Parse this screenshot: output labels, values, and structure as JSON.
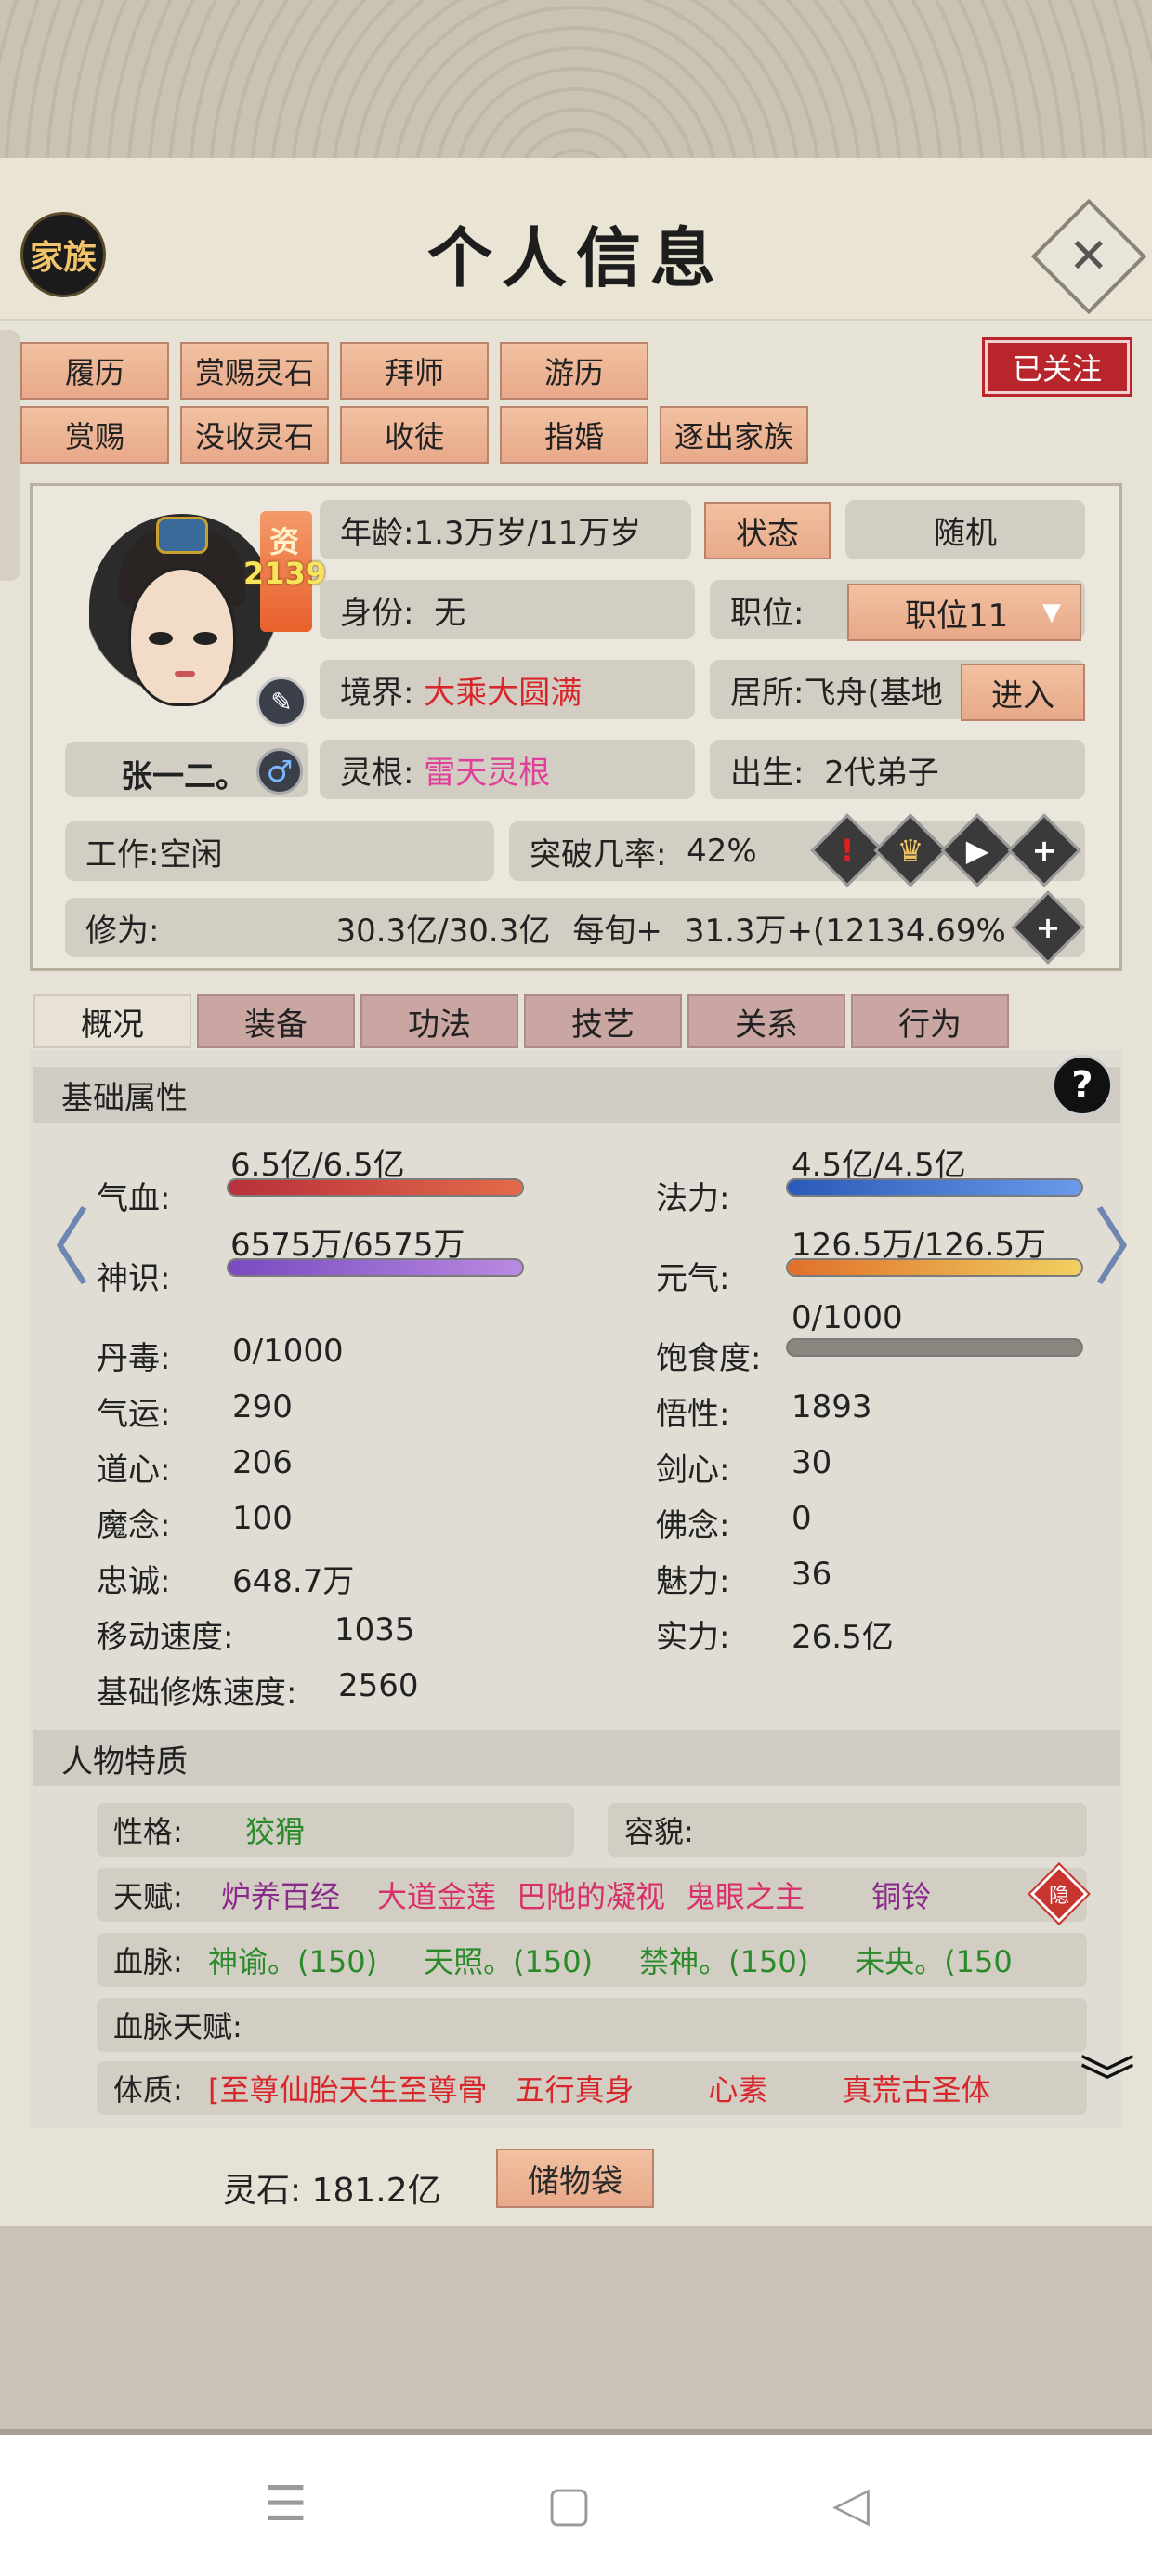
{
  "header": {
    "title": "个人信息",
    "family_button": "家族",
    "close_icon": "✕"
  },
  "actions": {
    "row1": [
      "履历",
      "赏赐灵石",
      "拜师",
      "游历"
    ],
    "row2": [
      "赏赐",
      "没收灵石",
      "收徒",
      "指婚",
      "逐出家族"
    ],
    "follow": "已关注"
  },
  "character": {
    "name": "张一二。",
    "aptitude_label": "资",
    "aptitude_value": "2139",
    "age_label": "年龄:",
    "age_value": "1.3万岁/11万岁",
    "status_button": "状态",
    "random_button": "随机",
    "identity_label": "身份:",
    "identity_value": "无",
    "position_label": "职位:",
    "position_value": "职位11",
    "realm_label": "境界:",
    "realm_value": "大乘大圆满",
    "residence_label": "居所:",
    "residence_value": "飞舟(基地",
    "enter_button": "进入",
    "root_label": "灵根:",
    "root_value": "雷天灵根",
    "birth_label": "出生:",
    "birth_value": "2代弟子",
    "job_label": "工作:",
    "job_value": "空闲",
    "breakthrough_label": "突破几率:",
    "breakthrough_value": "42%",
    "cultivation_label": "修为:",
    "cultivation_value": "30.3亿/30.3亿",
    "per_turn_label": "每旬+",
    "per_turn_value": "31.3万+(12134.69%"
  },
  "tabs": [
    "概况",
    "装备",
    "功法",
    "技艺",
    "关系",
    "行为"
  ],
  "basic": {
    "title": "基础属性",
    "qixue_label": "气血:",
    "qixue_value": "6.5亿/6.5亿",
    "qixue_fill": 1.0,
    "fali_label": "法力:",
    "fali_value": "4.5亿/4.5亿",
    "fali_fill": 1.0,
    "shenshi_label": "神识:",
    "shenshi_value": "6575万/6575万",
    "shenshi_fill": 1.0,
    "yuanqi_label": "元气:",
    "yuanqi_value": "126.5万/126.5万",
    "yuanqi_fill": 1.0,
    "baoshi_label": "饱食度:",
    "baoshi_value": "0/1000",
    "baoshi_fill": 0.0,
    "stats_left": [
      {
        "label": "丹毒:",
        "value": "0/1000"
      },
      {
        "label": "气运:",
        "value": "290"
      },
      {
        "label": "道心:",
        "value": "206"
      },
      {
        "label": "魔念:",
        "value": "100"
      },
      {
        "label": "忠诚:",
        "value": "648.7万"
      },
      {
        "label": "移动速度:",
        "value": "1035"
      },
      {
        "label": "基础修炼速度:",
        "value": "2560"
      }
    ],
    "stats_right": [
      {
        "label": "悟性:",
        "value": "1893"
      },
      {
        "label": "剑心:",
        "value": "30"
      },
      {
        "label": "佛念:",
        "value": "0"
      },
      {
        "label": "魅力:",
        "value": "36"
      },
      {
        "label": "实力:",
        "value": "26.5亿"
      }
    ]
  },
  "traits": {
    "title": "人物特质",
    "personality_label": "性格:",
    "personality_value": "狡猾",
    "appearance_label": "容貌:",
    "talent_label": "天赋:",
    "talents": [
      "炉养百经",
      "大道金莲",
      "巴阤的凝视",
      "鬼眼之主",
      "铜铃"
    ],
    "hide_button": "隐",
    "bloodline_label": "血脉:",
    "bloodlines": [
      "神谕。(150)",
      "天照。(150)",
      "禁神。(150)",
      "未央。(150"
    ],
    "bloodline_talent_label": "血脉天赋:",
    "physique_label": "体质:",
    "physiques": [
      "[至尊仙胎天生至尊骨",
      "五行真身",
      "心素",
      "真荒古圣体"
    ]
  },
  "footer": {
    "spirit_stones": "灵石: 181.2亿",
    "bag_button": "储物袋"
  },
  "colors": {
    "accent": "#e8a98a",
    "follow": "#b8262b",
    "realm": "#d8262b"
  }
}
